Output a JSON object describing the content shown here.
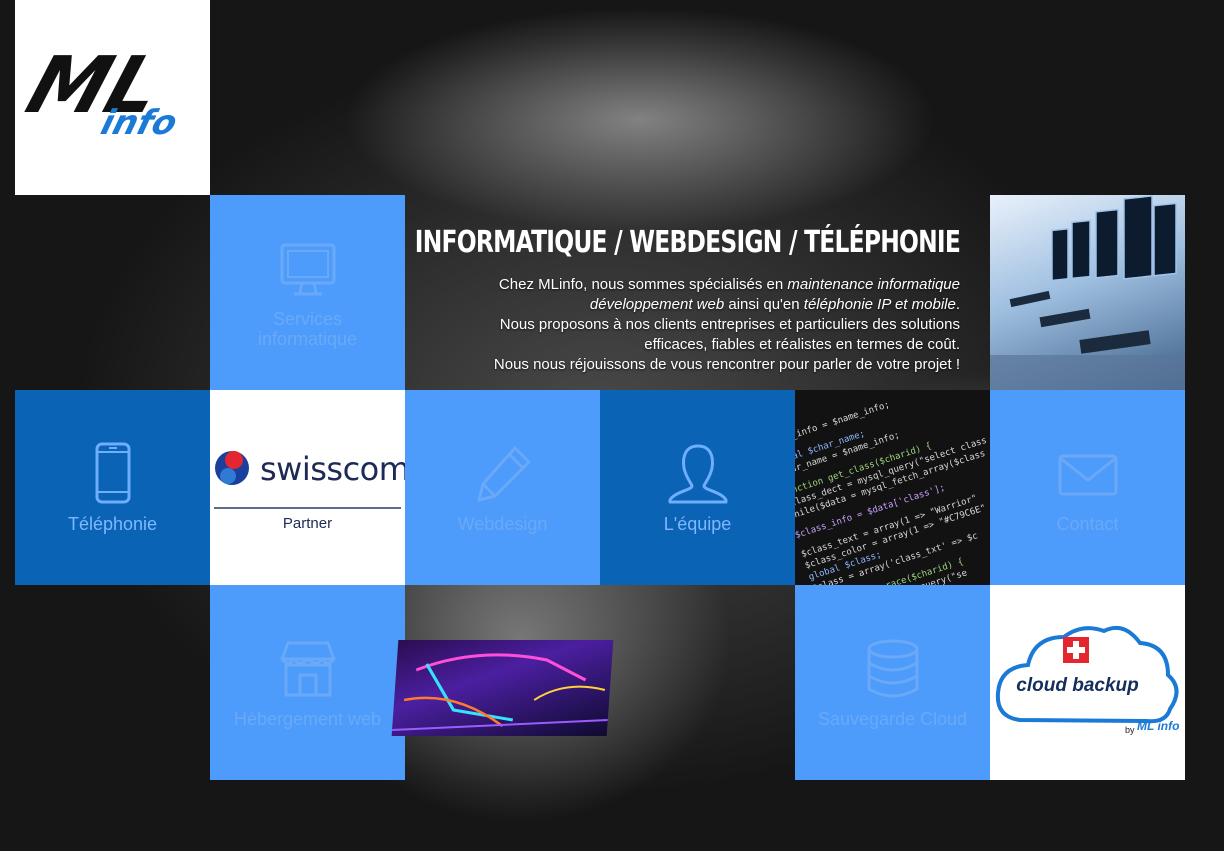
{
  "logo": {
    "text": "ML info"
  },
  "hero": {
    "title": "INFORMATIQUE / WEBDESIGN / TÉLÉPHONIE",
    "line1_a": "Chez MLinfo, nous sommes spécialisés en ",
    "line1_b": "maintenance informatique",
    "line2_a": "développement web",
    "line2_b": " ainsi qu'en ",
    "line2_c": "téléphonie IP et mobile",
    "line2_d": ".",
    "line3": "Nous proposons à nos clients entreprises et particuliers des solutions",
    "line4": "efficaces, fiables et réalistes en termes de coût.",
    "line5": "Nous nous réjouissons de vous rencontrer pour parler de votre projet !"
  },
  "tiles": {
    "services": "Services informatique",
    "telephonie": "Téléphonie",
    "webdesign": "Webdesign",
    "equipe": "L'équipe",
    "contact": "Contact",
    "hebergement": "Hébergement web",
    "sauvegarde": "Sauvegarde Cloud"
  },
  "swisscom": {
    "name": "swisscom",
    "sub": "Partner"
  },
  "cloud": {
    "text": "cloud backup",
    "by": "by",
    "brand": "ML info"
  },
  "colors": {
    "light_blue": "#4d9bfb",
    "dark_blue": "#0a63b5"
  }
}
